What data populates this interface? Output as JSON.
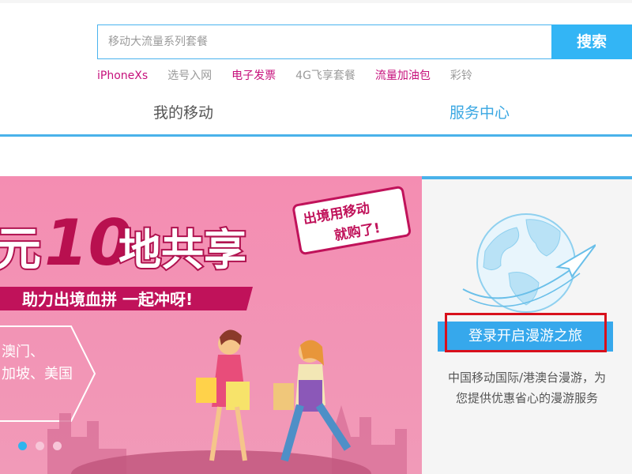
{
  "search": {
    "placeholder": "移动大流量系列套餐",
    "button_label": "搜索"
  },
  "hot_links": [
    {
      "label": "iPhoneXs",
      "style": "accent"
    },
    {
      "label": "选号入网",
      "style": "muted"
    },
    {
      "label": "电子发票",
      "style": "accent"
    },
    {
      "label": "4G飞享套餐",
      "style": "muted"
    },
    {
      "label": "流量加油包",
      "style": "accent"
    },
    {
      "label": "彩铃",
      "style": "muted"
    }
  ],
  "nav": {
    "mine": "我的移动",
    "service": "服务中心"
  },
  "banner": {
    "headline_prefix": "元",
    "headline_num": "10",
    "headline_rest": "地共享",
    "subline": "助力出境血拼  一起冲呀!",
    "badge_line1": "出境用移动",
    "badge_line2": "就购了!",
    "regions_line1": "澳门、",
    "regions_line2": "加坡、美国",
    "slide_count": 3,
    "active_slide": 1
  },
  "side_panel": {
    "login_button": "登录开启漫游之旅",
    "desc_line1": "中国移动国际/港澳台漫游，为",
    "desc_line2": "您提供优惠省心的漫游服务"
  },
  "colors": {
    "accent_blue": "#33b5f5",
    "nav_active": "#3aa7e2",
    "link_accent": "#c6117c",
    "banner_pink": "#f38bb0",
    "highlight_red": "#d8101c"
  }
}
